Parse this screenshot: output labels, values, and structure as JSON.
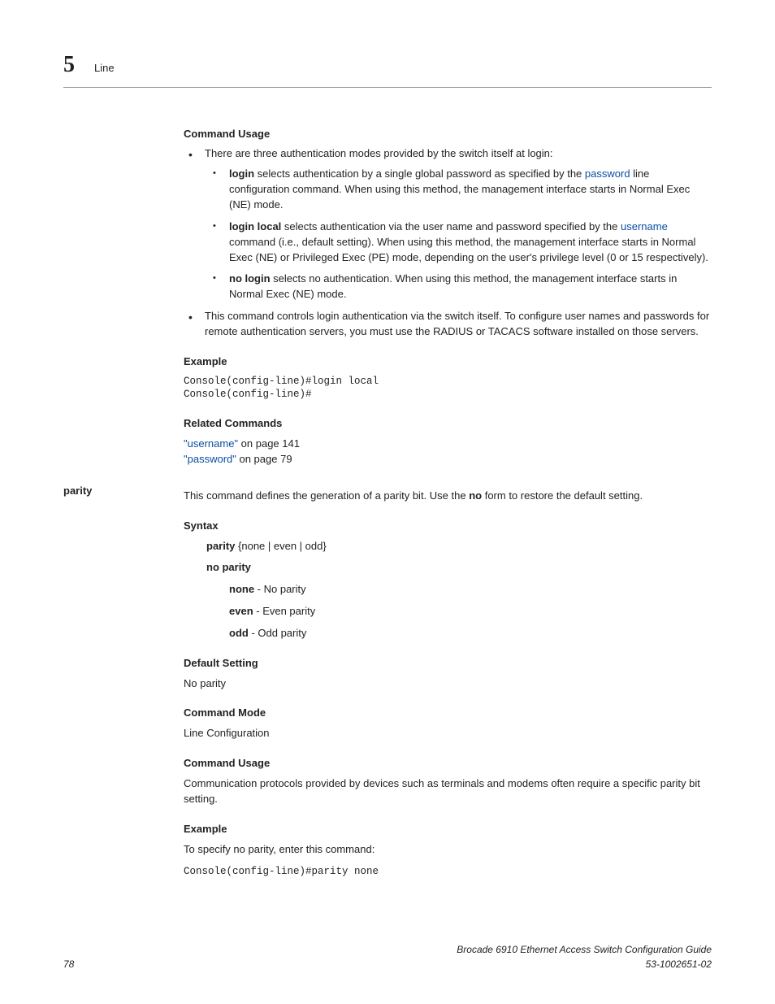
{
  "header": {
    "chapter_number": "5",
    "chapter_title": "Line"
  },
  "login_section": {
    "command_usage_heading": "Command Usage",
    "intro_bullet": "There are three authentication modes provided by the switch itself at login:",
    "sub_login": {
      "bold": "login",
      "text_before_link": " selects authentication by a single global password as specified by the ",
      "link": "password",
      "text_after_link": " line configuration command. When using this method, the management interface starts in Normal Exec (NE) mode."
    },
    "sub_login_local": {
      "bold": "login local",
      "text_before_link": " selects authentication via the user name and password specified by the ",
      "link": "username",
      "text_after_link": " command (i.e., default setting). When using this method, the management interface starts in Normal Exec (NE) or Privileged Exec (PE) mode, depending on the user's privilege level (0 or 15 respectively)."
    },
    "sub_no_login": {
      "bold": "no login",
      "text": " selects no authentication. When using this method, the management interface starts in Normal Exec (NE) mode."
    },
    "second_bullet": "This command controls login authentication via the switch itself. To configure user names and passwords for remote authentication servers, you must use the RADIUS or TACACS software installed on those servers.",
    "example_heading": "Example",
    "example_code": "Console(config-line)#login local\nConsole(config-line)#",
    "related_heading": "Related Commands",
    "related_username": "\"username\"",
    "related_username_suffix": " on page 141",
    "related_password": "\"password\"",
    "related_password_suffix": " on page 79"
  },
  "parity_section": {
    "side_label": "parity",
    "intro_before_bold": "This command defines the generation of a parity bit. Use the ",
    "intro_bold": "no",
    "intro_after_bold": " form to restore the default setting.",
    "syntax_heading": "Syntax",
    "syntax_line1_bold": "parity",
    "syntax_line1_rest": " {none | even | odd}",
    "syntax_line2": "no parity",
    "opt_none_bold": "none",
    "opt_none_text": " - No parity",
    "opt_even_bold": "even",
    "opt_even_text": " - Even parity",
    "opt_odd_bold": "odd",
    "opt_odd_text": " - Odd parity",
    "default_heading": "Default Setting",
    "default_value": "No parity",
    "mode_heading": "Command Mode",
    "mode_value": "Line Configuration",
    "usage_heading": "Command Usage",
    "usage_text": "Communication protocols provided by devices such as terminals and modems often require a specific parity bit setting.",
    "example_heading": "Example",
    "example_intro": "To specify no parity, enter this command:",
    "example_code": "Console(config-line)#parity none"
  },
  "footer": {
    "page_number": "78",
    "doc_title": "Brocade 6910 Ethernet Access Switch Configuration Guide",
    "doc_number": "53-1002651-02"
  }
}
